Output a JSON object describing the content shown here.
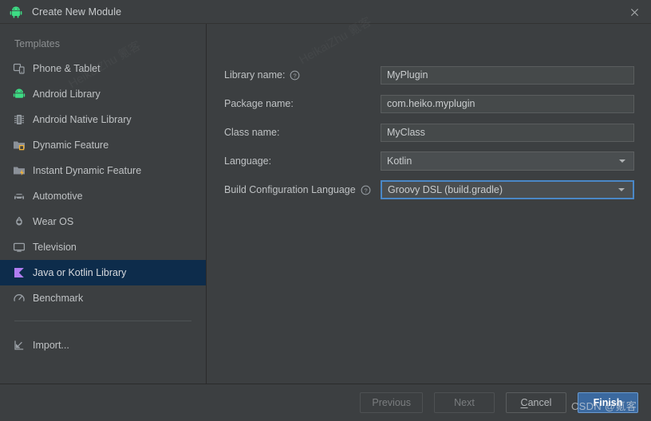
{
  "window": {
    "title": "Create New Module",
    "app_icon": "android-robot-icon",
    "close_label": "×"
  },
  "sidebar": {
    "header": "Templates",
    "items": [
      {
        "label": "Phone & Tablet",
        "icon": "phone-tablet-icon",
        "selected": false
      },
      {
        "label": "Android Library",
        "icon": "android-robot-icon",
        "selected": false
      },
      {
        "label": "Android Native Library",
        "icon": "native-chip-icon",
        "selected": false
      },
      {
        "label": "Dynamic Feature",
        "icon": "dynamic-feature-folder-icon",
        "selected": false
      },
      {
        "label": "Instant Dynamic Feature",
        "icon": "instant-feature-folder-icon",
        "selected": false
      },
      {
        "label": "Automotive",
        "icon": "car-icon",
        "selected": false
      },
      {
        "label": "Wear OS",
        "icon": "watch-icon",
        "selected": false
      },
      {
        "label": "Television",
        "icon": "television-icon",
        "selected": false
      },
      {
        "label": "Java or Kotlin Library",
        "icon": "kotlin-library-icon",
        "selected": true
      },
      {
        "label": "Benchmark",
        "icon": "benchmark-gauge-icon",
        "selected": false
      }
    ],
    "import": {
      "label": "Import...",
      "icon": "import-arrow-icon"
    }
  },
  "form": {
    "rows": [
      {
        "label": "Library name:",
        "help": true,
        "type": "text",
        "value": "MyPlugin",
        "focused": false
      },
      {
        "label": "Package name:",
        "help": false,
        "type": "text",
        "value": "com.heiko.myplugin",
        "focused": false
      },
      {
        "label": "Class name:",
        "help": false,
        "type": "text",
        "value": "MyClass",
        "focused": false
      },
      {
        "label": "Language:",
        "help": false,
        "type": "combo",
        "value": "Kotlin",
        "focused": false
      },
      {
        "label": "Build Configuration Language",
        "help": true,
        "type": "combo",
        "value": "Groovy DSL (build.gradle)",
        "focused": true
      }
    ]
  },
  "footer": {
    "buttons": [
      {
        "label": "Previous",
        "state": "disabled",
        "primary": false,
        "mnemonic": ""
      },
      {
        "label": "Next",
        "state": "disabled",
        "primary": false,
        "mnemonic": ""
      },
      {
        "label": "Cancel",
        "state": "enabled",
        "primary": false,
        "mnemonic": "C"
      },
      {
        "label": "Finish",
        "state": "enabled",
        "primary": true,
        "mnemonic": ""
      }
    ]
  },
  "watermarks": {
    "csdn": "CSDN @氪客",
    "diagonal": "HeikaiZhu 氪客"
  },
  "colors": {
    "window_bg": "#3c3f41",
    "selection_bg": "#0d2c4b",
    "accent_focus": "#4a88c7",
    "primary_button": "#3b699f",
    "android_green": "#3ddc84",
    "kotlin_purple": "#b07cf0",
    "folder_gray": "#8b9199",
    "instant_yellow": "#f2b134"
  }
}
